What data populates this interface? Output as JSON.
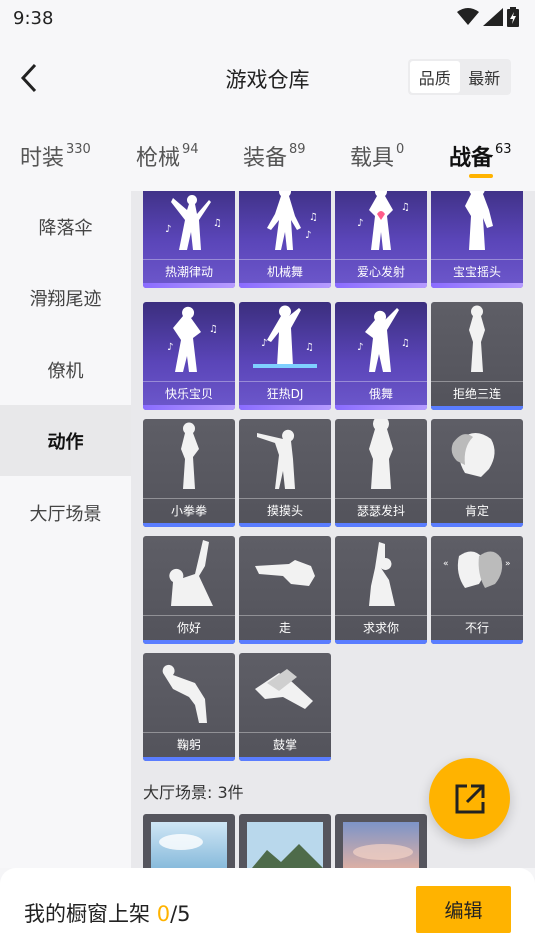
{
  "status": {
    "time": "9:38",
    "icons": [
      "wifi-icon",
      "signal-icon",
      "battery-icon"
    ]
  },
  "header": {
    "title": "游戏仓库",
    "segment": [
      {
        "label": "品质",
        "active": true
      },
      {
        "label": "最新",
        "active": false
      }
    ]
  },
  "tabs": [
    {
      "label": "时装",
      "count": "330"
    },
    {
      "label": "枪械",
      "count": "94"
    },
    {
      "label": "装备",
      "count": "89"
    },
    {
      "label": "载具",
      "count": "0"
    },
    {
      "label": "战备",
      "count": "63",
      "active": true
    }
  ],
  "sidebar": [
    {
      "label": "降落伞"
    },
    {
      "label": "滑翔尾迹"
    },
    {
      "label": "僚机"
    },
    {
      "label": "动作",
      "active": true
    },
    {
      "label": "大厅场景"
    }
  ],
  "emotes": [
    {
      "label": "热潮律动",
      "rarity": "purple"
    },
    {
      "label": "机械舞",
      "rarity": "purple"
    },
    {
      "label": "爱心发射",
      "rarity": "purple"
    },
    {
      "label": "宝宝摇头",
      "rarity": "purple"
    },
    {
      "label": "快乐宝贝",
      "rarity": "purple"
    },
    {
      "label": "狂热DJ",
      "rarity": "purple"
    },
    {
      "label": "俄舞",
      "rarity": "purple"
    },
    {
      "label": "拒绝三连",
      "rarity": "gray"
    },
    {
      "label": "小拳拳",
      "rarity": "gray"
    },
    {
      "label": "摸摸头",
      "rarity": "gray"
    },
    {
      "label": "瑟瑟发抖",
      "rarity": "gray"
    },
    {
      "label": "肯定",
      "rarity": "gray"
    },
    {
      "label": "你好",
      "rarity": "gray"
    },
    {
      "label": "走",
      "rarity": "gray"
    },
    {
      "label": "求求你",
      "rarity": "gray"
    },
    {
      "label": "不行",
      "rarity": "gray"
    },
    {
      "label": "鞠躬",
      "rarity": "gray"
    },
    {
      "label": "鼓掌",
      "rarity": "gray"
    }
  ],
  "lobby": {
    "title": "大厅场景: 3件",
    "scenes": [
      "sky-scene",
      "mountain-scene",
      "sunset-scene"
    ]
  },
  "fab": {
    "icon": "share-icon"
  },
  "bottom": {
    "prefix": "我的橱窗上架 ",
    "count": "0",
    "total": "/5",
    "edit_label": "编辑"
  },
  "colors": {
    "accent": "#ffb300",
    "purple_card": "#5a45b8",
    "gray_card": "#5e5e66",
    "blue_bar": "#5a7dff"
  }
}
